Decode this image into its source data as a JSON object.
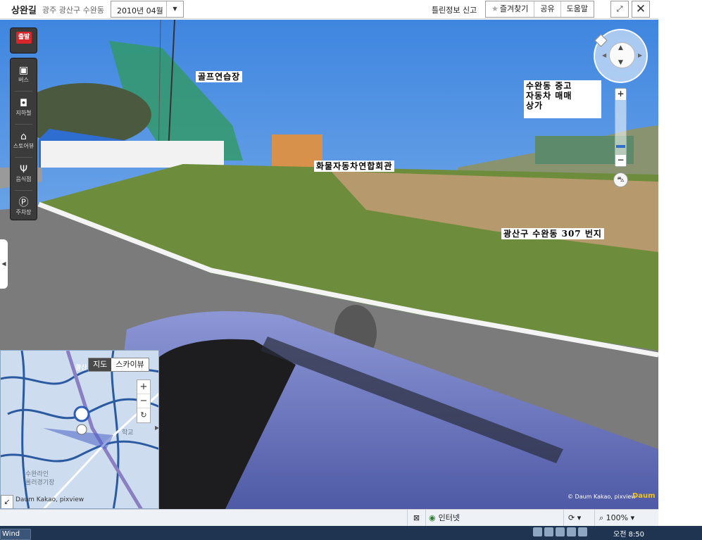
{
  "header": {
    "road_name": "상완길",
    "address": "광주 광산구 수완동",
    "date_select": "2010년 04월",
    "report_link": "틀린정보 신고",
    "buttons": [
      "즐겨찾기",
      "공유",
      "도움말"
    ]
  },
  "panorama": {
    "labels": {
      "golf": "골프연습장",
      "used_car": "수완동 중고\n자동차 매매\n상가",
      "truck_assoc": "화물자동차연합회관",
      "address_lot": "광산구 수완동 307 번지"
    },
    "credit": "© Daum Kakao, pixview",
    "logo": "Daum"
  },
  "rail": {
    "start": "출발",
    "items": [
      {
        "label": "버스",
        "icon": "bus-icon"
      },
      {
        "label": "지하철",
        "icon": "subway-icon"
      },
      {
        "label": "스토어뷰",
        "icon": "store-icon"
      },
      {
        "label": "음식점",
        "icon": "restaurant-icon"
      },
      {
        "label": "주차장",
        "icon": "parking-icon"
      }
    ]
  },
  "minimap": {
    "tabs": [
      "지도",
      "스카이뷰"
    ],
    "active_tab": "지도",
    "labels": [
      "광산",
      "수완라인",
      "롤러경기장",
      "학교"
    ],
    "credit": "Daum Kakao, pixview"
  },
  "status_bar": {
    "zone": "인터넷",
    "zoom": "100%"
  },
  "taskbar": {
    "item": "Wind",
    "clock": "오전 8:50"
  },
  "colors": {
    "sky": "#5fa0e8",
    "accent_red": "#d8262b",
    "rail_bg": "#3b3b3b"
  }
}
